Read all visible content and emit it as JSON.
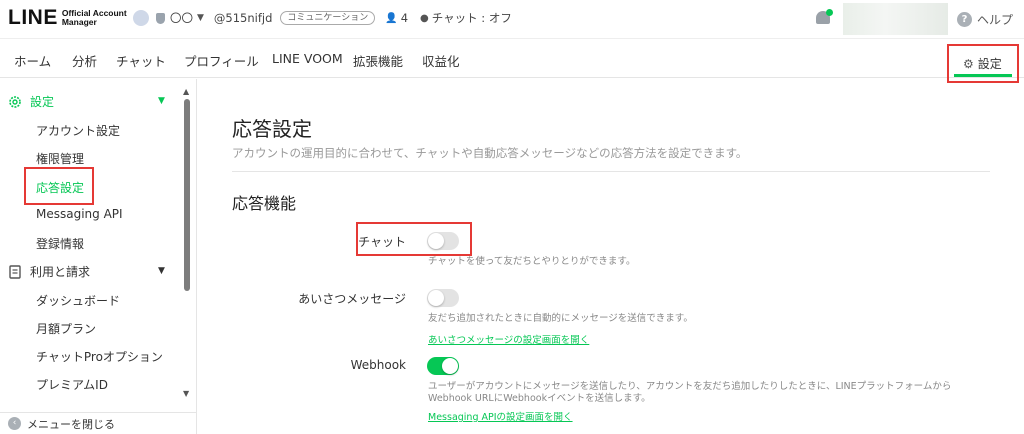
{
  "header": {
    "logo_main": "LINE",
    "logo_sub_line1": "Official Account",
    "logo_sub_line2": "Manager",
    "account_name": "〇〇",
    "account_id": "@515nifjd",
    "badge": "コミュニケーション",
    "friends_count": "4",
    "chat_status": "チャット : オフ",
    "help_label": "ヘルプ"
  },
  "nav": {
    "tabs": [
      "ホーム",
      "分析",
      "チャット",
      "プロフィール",
      "LINE VOOM",
      "拡張機能",
      "収益化"
    ],
    "settings_label": "設定"
  },
  "sidebar": {
    "section1": "設定",
    "items1": [
      "アカウント設定",
      "権限管理",
      "応答設定",
      "Messaging API",
      "登録情報"
    ],
    "section2": "利用と請求",
    "items2": [
      "ダッシュボード",
      "月額プラン",
      "チャットProオプション",
      "プレミアムID"
    ],
    "close_menu": "メニューを閉じる"
  },
  "main": {
    "title": "応答設定",
    "description": "アカウントの運用目的に合わせて、チャットや自動応答メッセージなどの応答方法を設定できます。",
    "section_title": "応答機能",
    "rows": [
      {
        "label": "チャット",
        "on": false,
        "desc": "チャットを使って友だちとやりとりができます。",
        "link": ""
      },
      {
        "label": "あいさつメッセージ",
        "on": false,
        "desc": "友だち追加されたときに自動的にメッセージを送信できます。",
        "link": "あいさつメッセージの設定画面を開く"
      },
      {
        "label": "Webhook",
        "on": true,
        "desc": "ユーザーがアカウントにメッセージを送信したり、アカウントを友だち追加したりしたときに、LINEプラットフォームからWebhook URLにWebhookイベントを送信します。",
        "link": "Messaging APIの設定画面を開く"
      }
    ]
  },
  "colors": {
    "accent": "#06c755",
    "highlight": "#e53935"
  }
}
